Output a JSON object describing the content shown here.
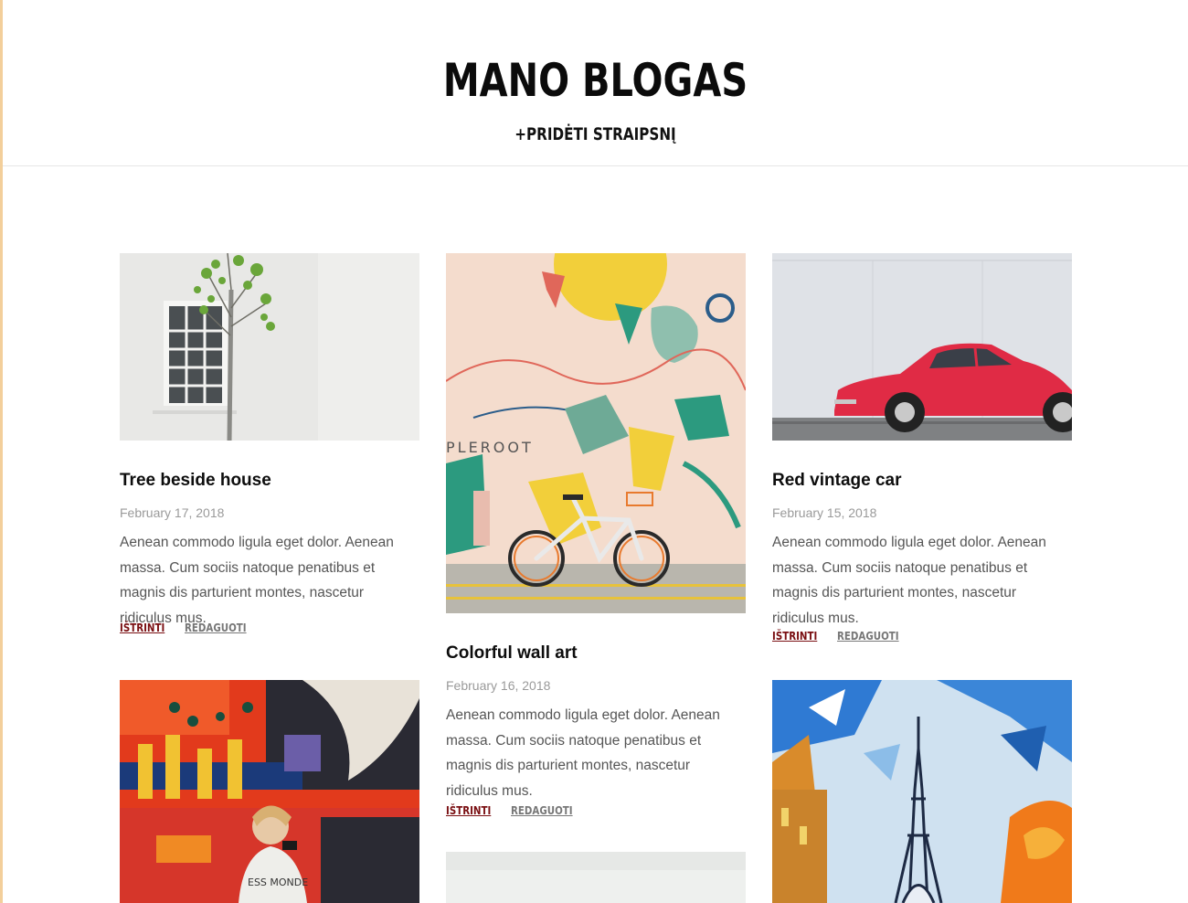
{
  "header": {
    "title": "MANO BLOGAS",
    "add_link": "+PRIDĖTI STRAIPSNĮ"
  },
  "posts": [
    {
      "title": "Tree beside house",
      "date": "February 17, 2018",
      "excerpt": "Aenean commodo ligula eget dolor. Aenean massa. Cum sociis natoque penatibus et magnis dis parturient montes, nascetur ridiculus mus.",
      "delete_label": "IŠTRINTI",
      "edit_label": "REDAGUOTI"
    },
    {
      "title": "Colorful wall art",
      "date": "February 16, 2018",
      "excerpt": "Aenean commodo ligula eget dolor. Aenean massa. Cum sociis natoque penatibus et magnis dis parturient montes, nascetur ridiculus mus.",
      "delete_label": "IŠTRINTI",
      "edit_label": "REDAGUOTI"
    },
    {
      "title": "Red vintage car",
      "date": "February 15, 2018",
      "excerpt": "Aenean commodo ligula eget dolor. Aenean massa. Cum sociis natoque penatibus et magnis dis parturient montes, nascetur ridiculus mus.",
      "delete_label": "IŠTRINTI",
      "edit_label": "REDAGUOTI"
    }
  ],
  "colors": {
    "delete": "#7a0f12",
    "edit": "#777777",
    "accent_bar": "#f3cf9b"
  }
}
